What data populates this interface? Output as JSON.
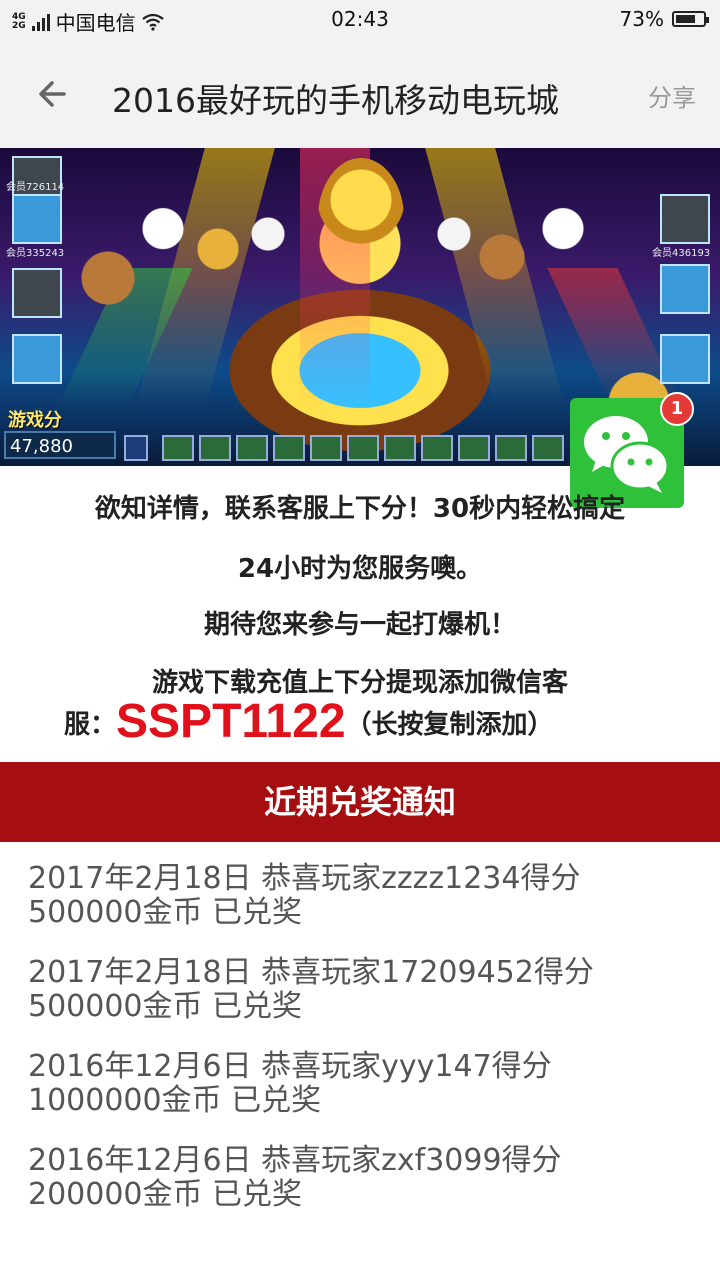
{
  "statusbar": {
    "carrier": "中国电信",
    "network": "4G\n2G",
    "time": "02:43",
    "battery": "73%",
    "battery_level": 0.73
  },
  "header": {
    "title": "2016最好玩的手机移动电玩城",
    "share_label": "分享"
  },
  "banner": {
    "score_label": "游戏分",
    "score_value": "47,880",
    "player_left": "会员726114",
    "player_left2": "会员335243",
    "player_right": "会员436193"
  },
  "wechat": {
    "badge": "1"
  },
  "info": {
    "line1": "欲知详情，联系客服上下分！30秒内轻松搞定",
    "line2": "24小时为您服务噢。",
    "line3": "期待您来参与一起打爆机！",
    "line4": "游戏下载充值上下分提现添加微信客",
    "line5_prefix": "服：",
    "contact_code": "SSPT1122",
    "line5_suffix": "（长按复制添加）"
  },
  "notice": {
    "title": "近期兑奖通知"
  },
  "winners": [
    {
      "line1": "2017年2月18日 恭喜玩家zzzz1234得分",
      "line2": "500000金币 已兑奖"
    },
    {
      "line1": "2017年2月18日 恭喜玩家17209452得分",
      "line2": "500000金币 已兑奖"
    },
    {
      "line1": "2016年12月6日 恭喜玩家yyy147得分",
      "line2": "1000000金币 已兑奖"
    },
    {
      "line1": "2016年12月6日 恭喜玩家zxf3099得分",
      "line2": "200000金币 已兑奖"
    }
  ],
  "colors": {
    "accent_red": "#a50f12",
    "code_red": "#e0111a",
    "wechat_green": "#2fc13a"
  }
}
